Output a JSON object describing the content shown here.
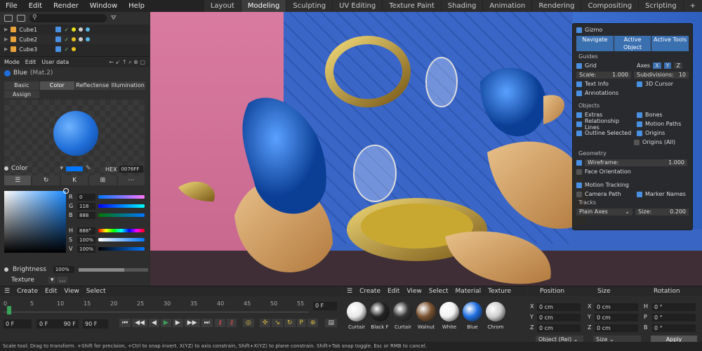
{
  "menu": [
    "File",
    "Edit",
    "Render",
    "Window",
    "Help"
  ],
  "workspaces": [
    "Layout",
    "Modeling",
    "Sculpting",
    "UV Editing",
    "Texture Paint",
    "Shading",
    "Animation",
    "Rendering",
    "Compositing",
    "Scripting",
    "+"
  ],
  "active_workspace": "Modeling",
  "outliner": {
    "items": [
      "Cube1",
      "Cube2",
      "Cube3"
    ]
  },
  "attributes": {
    "menu": [
      "Mode",
      "Edit",
      "User data"
    ],
    "material_name": "Blue",
    "material_id": "(Mat.2)",
    "tabs": [
      "Basic",
      "Color",
      "Reflectense",
      "Illumination"
    ],
    "active_tab": "Color",
    "assign": "Assign",
    "color_label": "Color",
    "hex_label": "HEX",
    "hex_value": "0076FF",
    "channels": [
      {
        "label": "R",
        "value": "0",
        "level": 0.0
      },
      {
        "label": "G",
        "value": "118",
        "level": 0.46
      },
      {
        "label": "B",
        "value": "888",
        "level": 0.5
      }
    ],
    "hsv": [
      {
        "label": "H",
        "value": "888°",
        "level": 0.6
      },
      {
        "label": "S",
        "value": "100%",
        "level": 1.0
      },
      {
        "label": "V",
        "value": "100%",
        "level": 1.0
      }
    ],
    "brightness_label": "Brightness",
    "brightness_value": "100%",
    "brightness_level": 0.66,
    "texture_label": "Texture",
    "texture_value": "..."
  },
  "overlay": {
    "gizmo": "Gizmo",
    "gizmo_buttons": [
      "Navigate",
      "Active Object",
      "Active Tools"
    ],
    "guides_title": "Guides",
    "grid": "Grid",
    "axes_label": "Axes",
    "axes": [
      "X",
      "Y",
      "Z"
    ],
    "scale_label": "Scale:",
    "scale_value": "1.000",
    "subdiv_label": "Subdivisions:",
    "subdiv_value": "10",
    "text_info": "Text Info",
    "cursor_3d": "3D Cursor",
    "annotations": "Annotations",
    "objects_title": "Objects",
    "extras": "Extras",
    "bones": "Bones",
    "relationship": "Relationship Lines",
    "motion_paths": "Motion Paths",
    "outline": "Outline Selected",
    "origins": "Origins",
    "origins_all": "Origins (All)",
    "geometry_title": "Geometry",
    "wireframe_label": "Wireframe:",
    "wireframe_value": "1.000",
    "face_orientation": "Face Orientation",
    "motion_tracking": "Motion Tracking",
    "camera_path": "Camera Path",
    "marker_names": "Marker Names",
    "tracks_title": "Tracks",
    "tracks_value": "Plain Axes",
    "size_label": "Size:",
    "size_value": "0.200"
  },
  "timeline": {
    "menu": [
      "Create",
      "Edit",
      "View",
      "Select"
    ],
    "ticks": [
      "0",
      "5",
      "10",
      "15",
      "20",
      "25",
      "30",
      "35",
      "40",
      "45",
      "50",
      "55"
    ],
    "current_frame": "0 F",
    "start": "0 F",
    "min": "0 F",
    "max": "90 F",
    "end": "90 F"
  },
  "materials": {
    "menu": [
      "Create",
      "Edit",
      "View",
      "Select",
      "Material",
      "Texture"
    ],
    "items": [
      {
        "label": "Curtair",
        "color": "#e8e8e8"
      },
      {
        "label": "Black F",
        "color": "#222222"
      },
      {
        "label": "Curtair",
        "color": "#333333"
      },
      {
        "label": "Walnut",
        "color": "#7a5230"
      },
      {
        "label": "White",
        "color": "#f2f2f2"
      },
      {
        "label": "Blue",
        "color": "#1e6ee0"
      },
      {
        "label": "Chrom",
        "color": "#cfcfcf"
      }
    ]
  },
  "coords": {
    "headers": [
      "Position",
      "Size",
      "Rotation"
    ],
    "rows": [
      {
        "axis": "X",
        "pos": "0 cm",
        "size": "0 cm",
        "rot_label": "H",
        "rot": "0 °"
      },
      {
        "axis": "Y",
        "pos": "0 cm",
        "size": "0 cm",
        "rot_label": "P",
        "rot": "0 °"
      },
      {
        "axis": "Z",
        "pos": "0 cm",
        "size": "0 cm",
        "rot_label": "B",
        "rot": "0 °"
      }
    ],
    "mode": "Object (Rel)",
    "size_mode": "Size",
    "apply": "Apply"
  },
  "status": "Scale tool: Drag to transform. +Shift for precision, +Ctrl to snap invert. X(YZ) to axis constrain, Shift+X(YZ) to plane constrain. Shift+Tab snap toggle. Esc or RMB to cancel.",
  "colors": {
    "accent": "#4a90e2",
    "blue_material": "#0076FF"
  }
}
